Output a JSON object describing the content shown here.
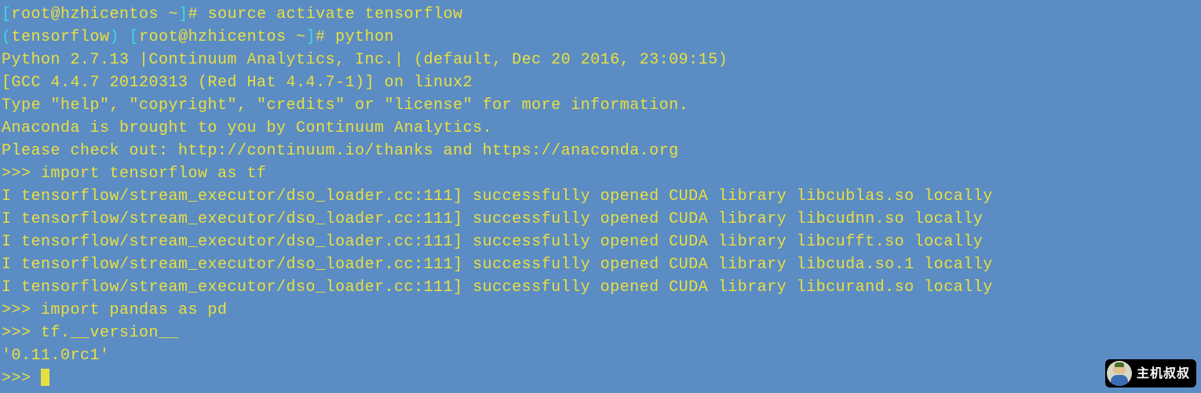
{
  "lines": {
    "l0_bracket_open": "[",
    "l0_prompt": "root@hzhicentos ~",
    "l0_bracket_close": "]",
    "l0_hash": "# ",
    "l0_cmd": "source activate tensorflow",
    "l1_env_open": "(",
    "l1_env": "tensorflow",
    "l1_env_close": ") ",
    "l1_bracket_open": "[",
    "l1_prompt": "root@hzhicentos ~",
    "l1_bracket_close": "]",
    "l1_hash": "# ",
    "l1_cmd": "python",
    "l2": "Python 2.7.13 |Continuum Analytics, Inc.| (default, Dec 20 2016, 23:09:15) ",
    "l3": "[GCC 4.4.7 20120313 (Red Hat 4.4.7-1)] on linux2",
    "l4": "Type \"help\", \"copyright\", \"credits\" or \"license\" for more information.",
    "l5": "Anaconda is brought to you by Continuum Analytics.",
    "l6": "Please check out: http://continuum.io/thanks and https://anaconda.org",
    "l7_prompt": ">>> ",
    "l7_cmd": "import tensorflow as tf",
    "l8": "I tensorflow/stream_executor/dso_loader.cc:111] successfully opened CUDA library libcublas.so locally",
    "l9": "I tensorflow/stream_executor/dso_loader.cc:111] successfully opened CUDA library libcudnn.so locally",
    "l10": "I tensorflow/stream_executor/dso_loader.cc:111] successfully opened CUDA library libcufft.so locally",
    "l11": "I tensorflow/stream_executor/dso_loader.cc:111] successfully opened CUDA library libcuda.so.1 locally",
    "l12": "I tensorflow/stream_executor/dso_loader.cc:111] successfully opened CUDA library libcurand.so locally",
    "l13_prompt": ">>> ",
    "l13_cmd": "import pandas as pd",
    "l14_prompt": ">>> ",
    "l14_cmd": "tf.__version__",
    "l15": "'0.11.0rc1'",
    "l16_prompt": ">>> "
  },
  "watermark": {
    "text": "主机叔叔"
  }
}
